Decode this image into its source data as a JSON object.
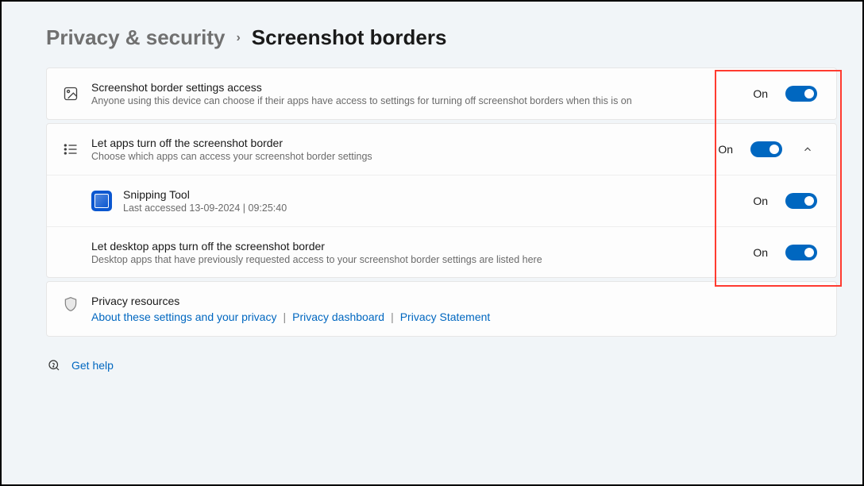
{
  "breadcrumb": {
    "prev": "Privacy & security",
    "curr": "Screenshot borders"
  },
  "rows": {
    "access": {
      "title": "Screenshot border settings access",
      "sub": "Anyone using this device can choose if their apps have access to settings for turning off screenshot borders when this is on",
      "status": "On"
    },
    "apps": {
      "title": "Let apps turn off the screenshot border",
      "sub": "Choose which apps can access your screenshot border settings",
      "status": "On"
    },
    "snip": {
      "title": "Snipping Tool",
      "sub": "Last accessed 13-09-2024  |  09:25:40",
      "status": "On"
    },
    "desktop": {
      "title": "Let desktop apps turn off the screenshot border",
      "sub": "Desktop apps that have previously requested access to your screenshot border settings are listed here",
      "status": "On"
    }
  },
  "privacy": {
    "heading": "Privacy resources",
    "link1": "About these settings and your privacy",
    "link2": "Privacy dashboard",
    "link3": "Privacy Statement"
  },
  "help": {
    "label": "Get help"
  }
}
